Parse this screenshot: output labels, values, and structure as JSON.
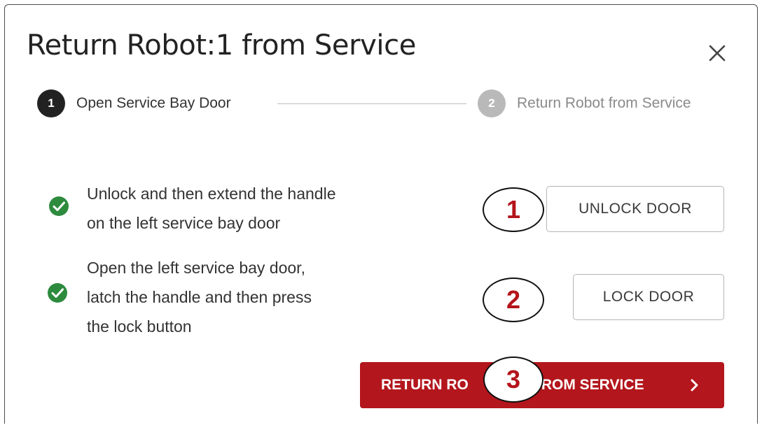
{
  "dialog": {
    "title": "Return Robot:1 from Service",
    "close_icon": "close-icon"
  },
  "stepper": {
    "steps": [
      {
        "number": "1",
        "label": "Open Service Bay Door",
        "state": "active"
      },
      {
        "number": "2",
        "label": "Return Robot from Service",
        "state": "inactive"
      }
    ]
  },
  "instructions": [
    {
      "lines": [
        "Unlock and then extend the handle",
        "on the left service bay door"
      ],
      "status_icon": "check-circle-icon",
      "button_label": "UNLOCK DOOR"
    },
    {
      "lines": [
        "Open the left service bay door,",
        "latch the handle and then press",
        "the lock button"
      ],
      "status_icon": "check-circle-icon",
      "button_label": "LOCK DOOR"
    }
  ],
  "primary_action": {
    "label_left": "RETURN RO",
    "label_right": "ROM SERVICE",
    "icon": "chevron-right-icon"
  },
  "callouts": [
    "1",
    "2",
    "3"
  ],
  "colors": {
    "accent": "#b3161c",
    "success": "#2e8b3e",
    "step_active": "#222222",
    "step_inactive": "#b9b9b9"
  }
}
